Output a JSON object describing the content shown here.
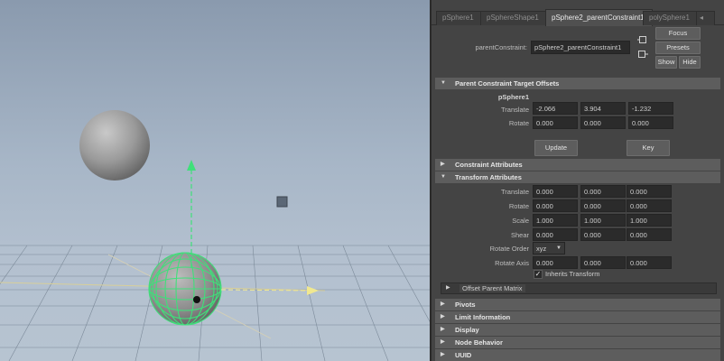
{
  "tabs": [
    {
      "label": "pSphere1"
    },
    {
      "label": "pSphereShape1"
    },
    {
      "label": "pSphere2_parentConstraint1"
    },
    {
      "label": "polySphere1"
    }
  ],
  "tab_overflow": "◂",
  "header": {
    "node_label": "parentConstraint:",
    "node_value": "pSphere2_parentConstraint1",
    "focus": "Focus",
    "presets": "Presets",
    "show": "Show",
    "hide": "Hide"
  },
  "sections": {
    "target_offsets": "Parent Constraint Target Offsets",
    "constraint_attrs": "Constraint Attributes",
    "transform_attrs": "Transform Attributes",
    "offset_parent_matrix": "Offset Parent Matrix",
    "pivots": "Pivots",
    "limit_info": "Limit Information",
    "display": "Display",
    "node_behavior": "Node Behavior",
    "uuid": "UUID"
  },
  "target_offsets": {
    "target": "pSphere1",
    "translate_label": "Translate",
    "translate": [
      "-2.066",
      "3.904",
      "-1.232"
    ],
    "rotate_label": "Rotate",
    "rotate": [
      "0.000",
      "0.000",
      "0.000"
    ],
    "update": "Update",
    "key": "Key"
  },
  "transform": {
    "rows": [
      {
        "label": "Translate",
        "values": [
          "0.000",
          "0.000",
          "0.000"
        ]
      },
      {
        "label": "Rotate",
        "values": [
          "0.000",
          "0.000",
          "0.000"
        ]
      },
      {
        "label": "Scale",
        "values": [
          "1.000",
          "1.000",
          "1.000"
        ]
      },
      {
        "label": "Shear",
        "values": [
          "0.000",
          "0.000",
          "0.000"
        ]
      }
    ],
    "rotate_order_label": "Rotate Order",
    "rotate_order": "xyz",
    "rotate_axis_label": "Rotate Axis",
    "rotate_axis": [
      "0.000",
      "0.000",
      "0.000"
    ],
    "inherits_label": "Inherits Transform",
    "inherits_checked": true
  },
  "colors": {
    "selection_green": "#3fe07a",
    "manipulator_yellow": "#f0e890"
  }
}
